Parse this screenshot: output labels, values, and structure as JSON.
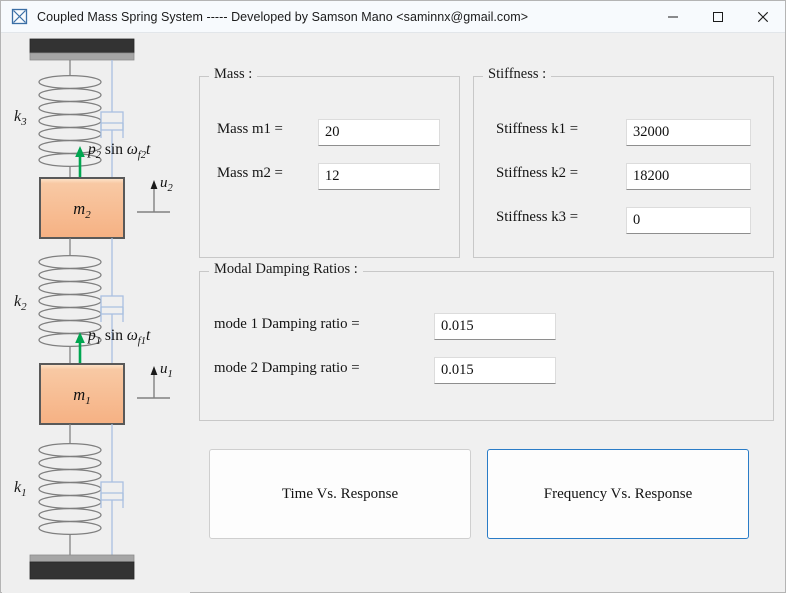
{
  "window": {
    "title": "Coupled Mass Spring System ----- Developed by Samson Mano <saminnx@gmail.com>",
    "icon": "app-diagram-icon",
    "controls": {
      "minimize": "minimize-icon",
      "maximize": "maximize-icon",
      "close": "close-icon"
    },
    "background_color": "#f0f0f0",
    "titlebar_color": "#f7fafd"
  },
  "diagram": {
    "panel_background": "#efefef",
    "mass_fill_color": "#f6b183",
    "mass_border_color": "#595959",
    "spring_color": "#7f7f7f",
    "damper_color": "#a9c0e0",
    "force_arrow_color": "#00a650",
    "support_dark_color": "#333333",
    "support_light_color": "#a6a6a6",
    "labels": {
      "k1": "k₁",
      "k2": "k₂",
      "k3": "k₃",
      "m1": "m₁",
      "m2": "m₂",
      "u1": "u₁",
      "u2": "u₂",
      "force1": "p₁ sin ω_f1 t",
      "force2": "p₂ sin ω_f2 t"
    }
  },
  "mass_group": {
    "legend": "Mass :",
    "fields": [
      {
        "label": "Mass m1 =",
        "value": "20",
        "placeholder": ""
      },
      {
        "label": "Mass m2 =",
        "value": "12",
        "placeholder": ""
      }
    ]
  },
  "stiffness_group": {
    "legend": "Stiffness :",
    "fields": [
      {
        "label": "Stiffness k1 =",
        "value": "32000",
        "placeholder": ""
      },
      {
        "label": "Stiffness k2 =",
        "value": "18200",
        "placeholder": ""
      },
      {
        "label": "Stiffness k3 =",
        "value": "0",
        "placeholder": ""
      }
    ]
  },
  "damping_group": {
    "legend": "Modal Damping Ratios :",
    "fields": [
      {
        "label": "mode 1 Damping ratio =",
        "value": "0.015",
        "placeholder": ""
      },
      {
        "label": "mode 2 Damping ratio =",
        "value": "0.015",
        "placeholder": ""
      }
    ]
  },
  "buttons": {
    "time_response": "Time Vs. Response",
    "frequency_response": "Frequency Vs. Response",
    "focused": "frequency_response",
    "focus_color": "#2a7cc7"
  }
}
